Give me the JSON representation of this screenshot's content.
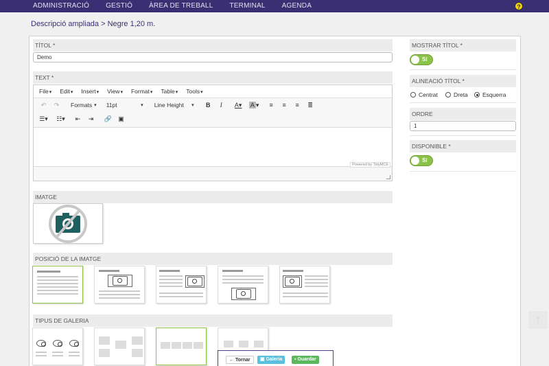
{
  "nav": {
    "items": [
      "ADMINISTRACIÓ",
      "GESTIÓ",
      "ÀREA DE TREBALL",
      "TERMINAL",
      "AGENDA"
    ],
    "help_icon": "?"
  },
  "breadcrumb": "Descripció ampliada > Negre 1,20 m.",
  "form": {
    "title_label": "TÍTOL *",
    "title_value": "Demo",
    "text_label": "TEXT *",
    "editor": {
      "menus": [
        "File",
        "Edit",
        "Insert",
        "View",
        "Format",
        "Table",
        "Tools"
      ],
      "formats_label": "Formats",
      "fontsize_label": "11pt",
      "lineheight_label": "Line Height",
      "powered": "Powered by TinyMCE"
    },
    "image_label": "IMATGE",
    "image_position_label": "POSICIÓ DE LA IMATGE",
    "gallery_type_label": "TIPUS DE GALERIA"
  },
  "side": {
    "show_title_label": "MOSTRAR TÍTOL *",
    "show_title_value": "Sí",
    "align_label": "ALINEACIÓ TÍTOL *",
    "align_options": [
      "Centrat",
      "Dreta",
      "Esquerra"
    ],
    "align_selected": "Esquerra",
    "order_label": "ORDRE",
    "order_value": "1",
    "available_label": "DISPONIBLE *",
    "available_value": "Sí"
  },
  "actions": {
    "back": "Tornar",
    "gallery": "Galeria",
    "save": "Guardar"
  },
  "colors": {
    "nav_bg": "#3a2f73",
    "accent_green": "#8bc34a",
    "btn_info": "#5bc0de",
    "btn_success": "#5cb85c"
  }
}
